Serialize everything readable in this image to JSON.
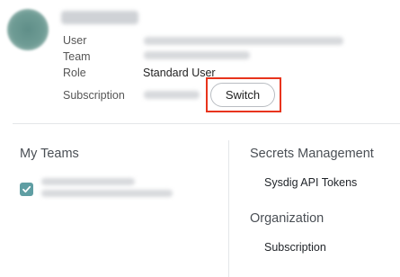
{
  "user": {
    "labels": {
      "user": "User",
      "team": "Team",
      "role": "Role",
      "subscription": "Subscription"
    },
    "role_value": "Standard User",
    "switch_label": "Switch"
  },
  "teams": {
    "title": "My Teams",
    "checked": true
  },
  "secrets": {
    "title": "Secrets Management",
    "items": [
      "Sysdig API Tokens"
    ]
  },
  "organization": {
    "title": "Organization",
    "items": [
      "Subscription"
    ]
  },
  "colors": {
    "highlight": "#e8341c",
    "checkbox": "#5f9ea3",
    "avatar": "#6f9c95"
  }
}
